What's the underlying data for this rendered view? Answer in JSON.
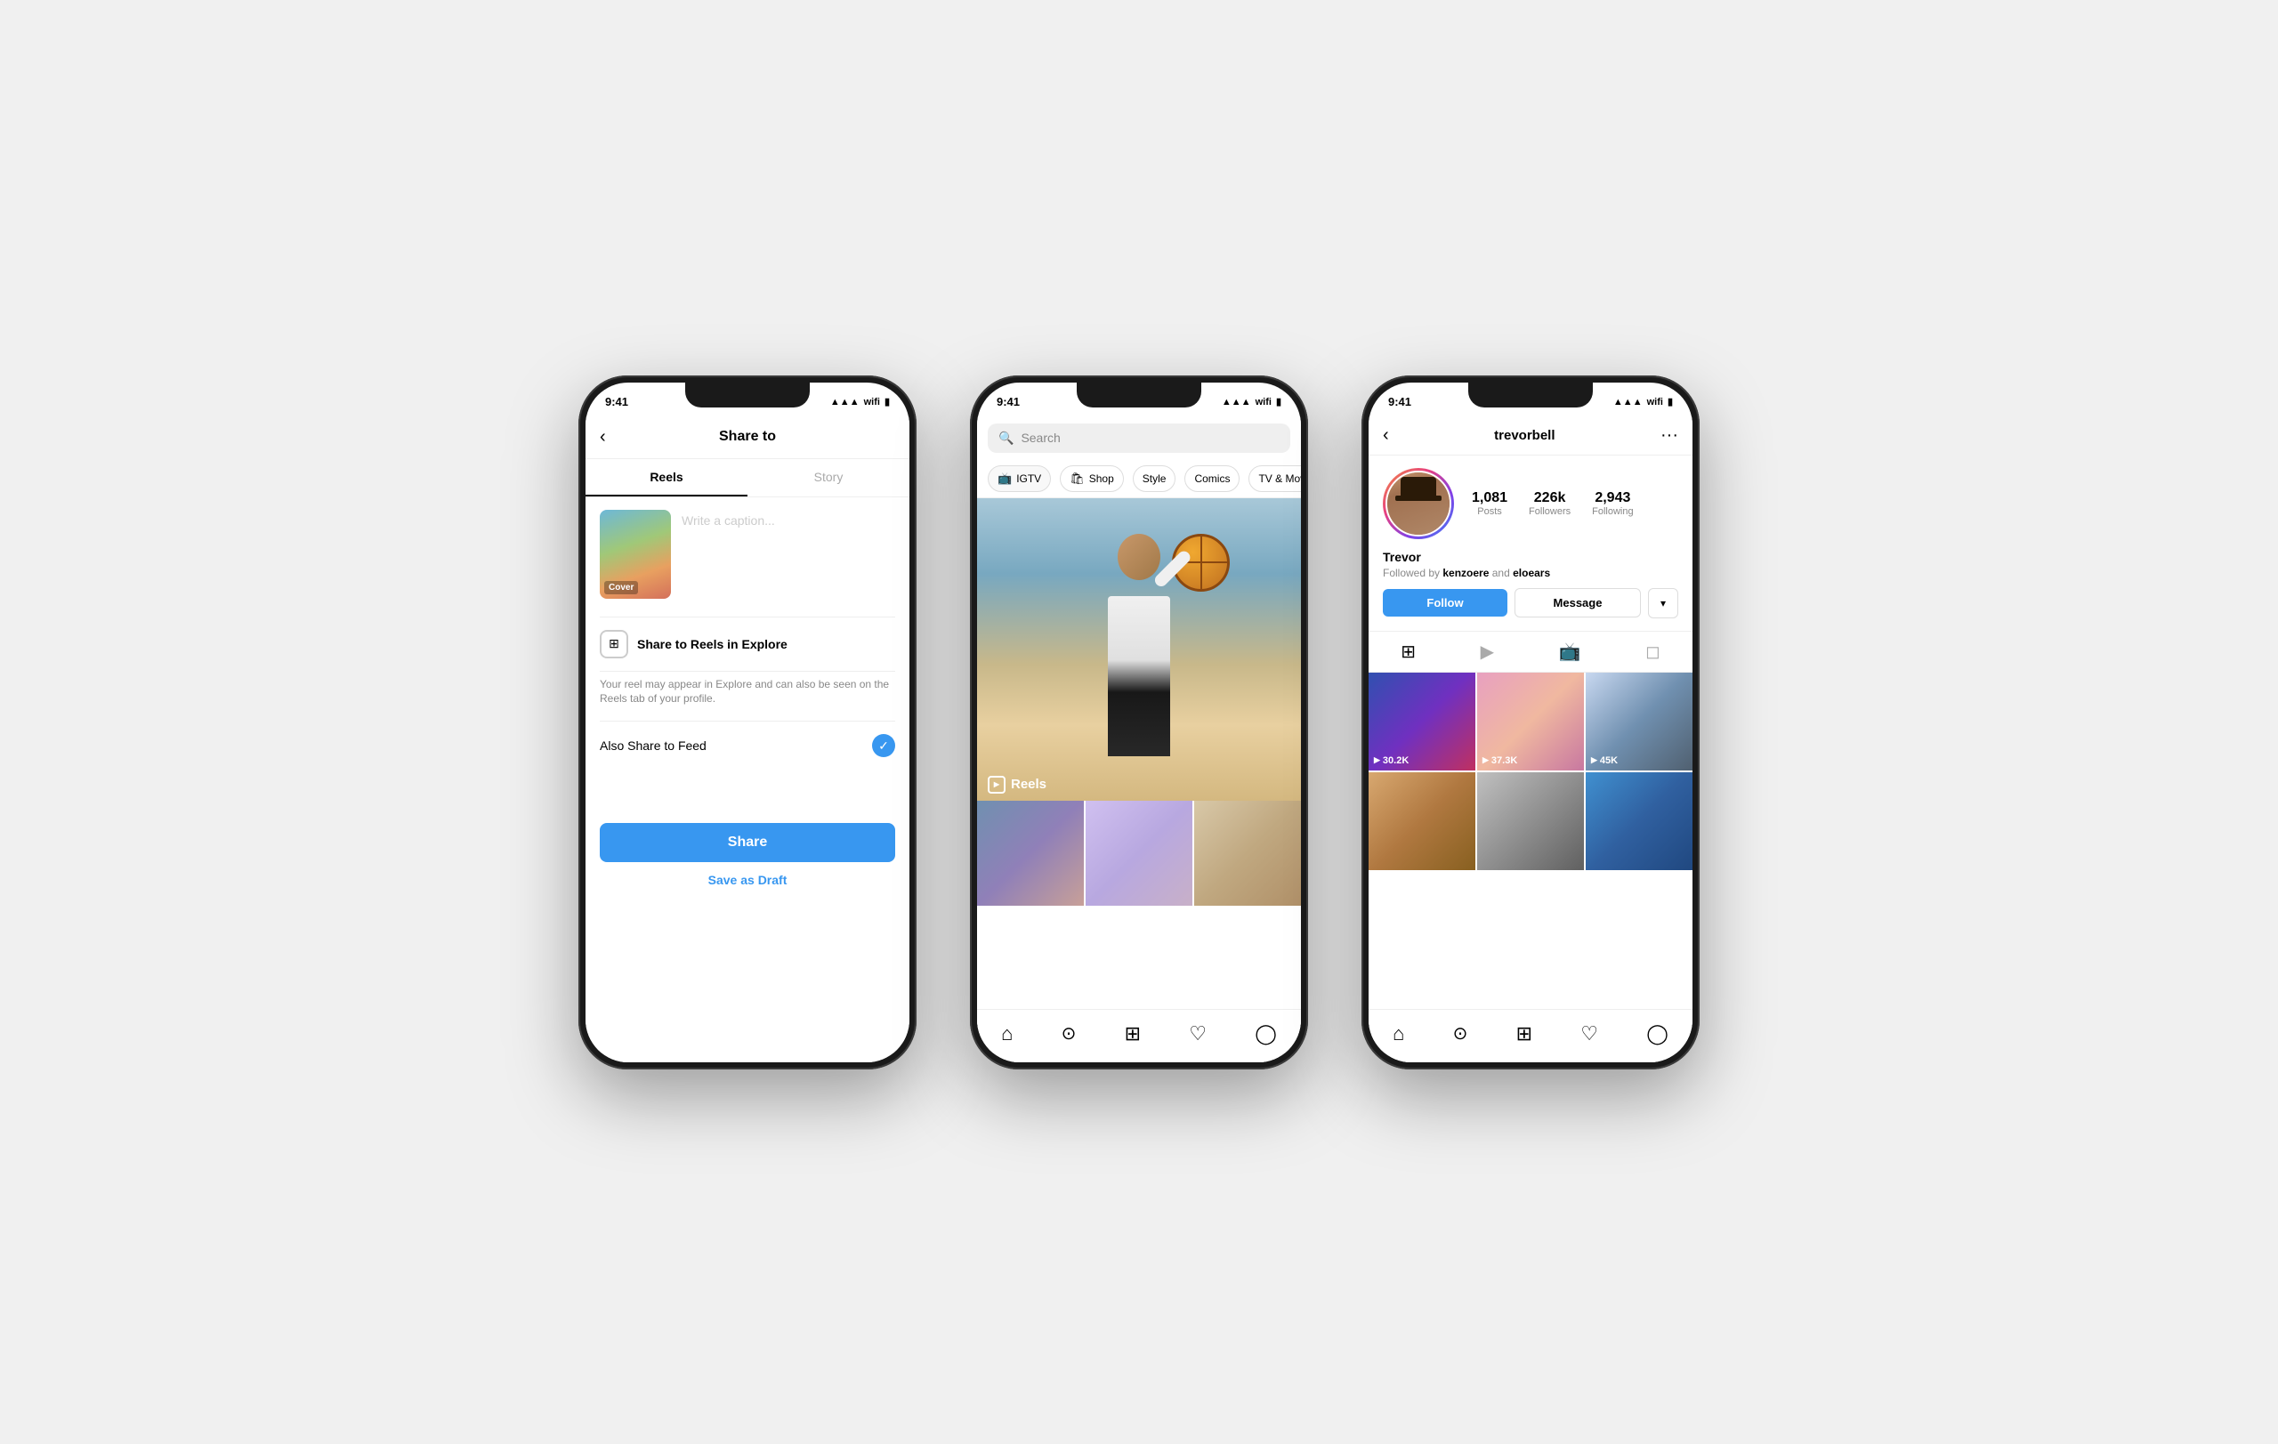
{
  "background": "#f0f0f0",
  "phones": {
    "phone1": {
      "statusTime": "9:41",
      "navBack": "‹",
      "navTitle": "Share to",
      "tabs": [
        {
          "label": "Reels",
          "active": true
        },
        {
          "label": "Story",
          "active": false
        }
      ],
      "coverLabel": "Cover",
      "captionPlaceholder": "Write a caption...",
      "exploreCheckbox": "Share to Reels in Explore",
      "exploreSubtext": "Your reel may appear in Explore and can also be seen on the Reels tab of your profile.",
      "feedLabel": "Also Share to Feed",
      "shareButton": "Share",
      "draftButton": "Save as Draft"
    },
    "phone2": {
      "statusTime": "9:41",
      "searchPlaceholder": "Search",
      "categories": [
        {
          "icon": "📺",
          "label": "IGTV"
        },
        {
          "icon": "🛍",
          "label": "Shop"
        },
        {
          "icon": "",
          "label": "Style"
        },
        {
          "icon": "",
          "label": "Comics"
        },
        {
          "icon": "",
          "label": "TV & Movie"
        }
      ],
      "reelsLabel": "Reels"
    },
    "phone3": {
      "statusTime": "9:41",
      "backIcon": "‹",
      "username": "trevorbell",
      "moreIcon": "···",
      "stats": {
        "posts": {
          "value": "1,081",
          "label": "Posts"
        },
        "followers": {
          "value": "226k",
          "label": "Followers"
        },
        "following": {
          "value": "2,943",
          "label": "Following"
        }
      },
      "name": "Trevor",
      "followedBy": "Followed by kenzoere and eloears",
      "followButton": "Follow",
      "messageButton": "Message",
      "gridCounts": [
        "30.2K",
        "37.3K",
        "45K",
        "–",
        "–",
        "–"
      ]
    }
  }
}
